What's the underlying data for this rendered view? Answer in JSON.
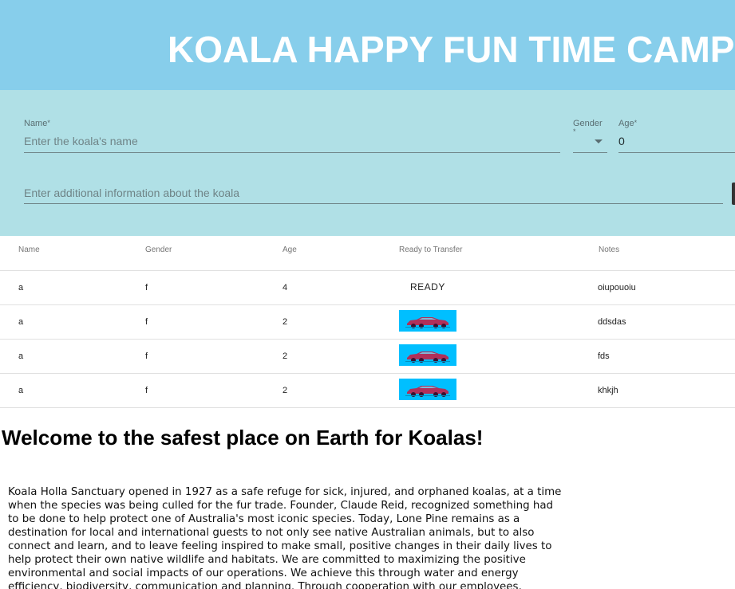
{
  "header": {
    "title": "KOALA HAPPY FUN TIME CAMP"
  },
  "form": {
    "name": {
      "label": "Name",
      "required_mark": "*",
      "placeholder": "Enter the koala's name",
      "value": ""
    },
    "gender": {
      "label": "Gender",
      "required_mark": "*",
      "value": ""
    },
    "age": {
      "label": "Age",
      "required_mark": "*",
      "value": "0"
    },
    "notes": {
      "placeholder": "Enter additional information about the koala",
      "value": ""
    }
  },
  "table": {
    "columns": [
      "Name",
      "Gender",
      "Age",
      "Ready to Transfer",
      "Notes"
    ],
    "rows": [
      {
        "name": "a",
        "gender": "f",
        "age": "4",
        "ready": "READY",
        "notes": "oiupouoiu"
      },
      {
        "name": "a",
        "gender": "f",
        "age": "2",
        "ready": "car-image",
        "notes": "ddsdas"
      },
      {
        "name": "a",
        "gender": "f",
        "age": "2",
        "ready": "car-image",
        "notes": "fds"
      },
      {
        "name": "a",
        "gender": "f",
        "age": "2",
        "ready": "car-image",
        "notes": "khkjh"
      }
    ]
  },
  "article": {
    "heading": "Welcome to the safest place on Earth for Koalas!",
    "body": "Koala Holla Sanctuary opened in 1927 as a safe refuge for sick, injured, and orphaned koalas, at a time when the species was being culled for the fur trade. Founder, Claude Reid, recognized something had to be done to help protect one of Australia's most iconic species. Today, Lone Pine remains as a destination for local and international guests to not only see native Australian animals, but to also connect and learn, and to leave feeling inspired to make small, positive changes in their daily lives to help protect their own native wildlife and habitats. We are committed to maximizing the positive environmental and social impacts of our operations. We achieve this through water and energy efficiency, biodiversity, communication and planning. Through cooperation with our employees, suppliers and customers, we aim"
  },
  "colors": {
    "header_bg": "#87ceeb",
    "form_bg": "#b0e0e6",
    "car_badge_bg": "#00bfff",
    "car_color": "#b0305a"
  },
  "icons": {
    "gender_select": "caret-down-icon",
    "transfer_vehicle": "car-icon"
  }
}
